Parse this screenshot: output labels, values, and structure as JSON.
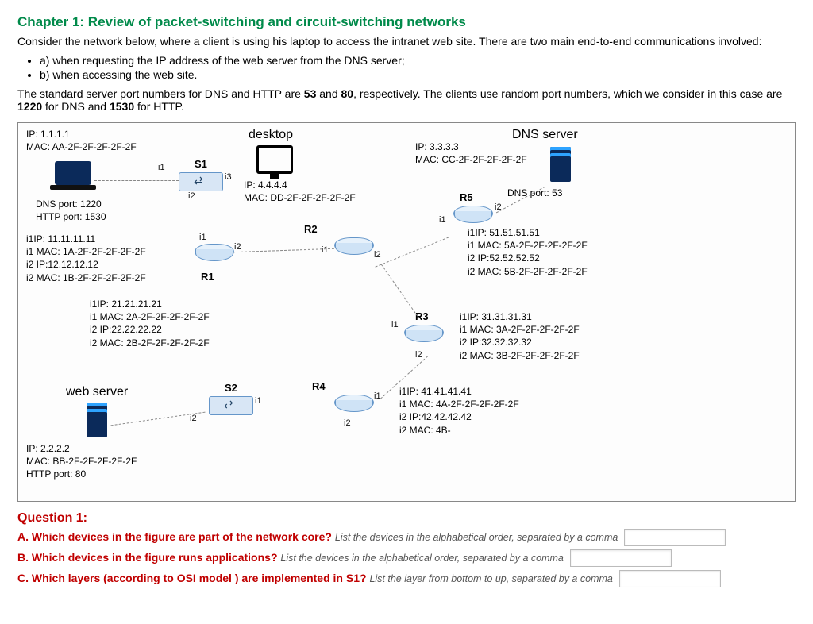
{
  "chapter_title": "Chapter 1: Review of packet-switching and circuit-switching networks",
  "intro": "Consider the network below, where a client is using his laptop to access the intranet web site. There are two main end-to-end communications involved:",
  "scenarios": [
    "a) when requesting the IP address of the web server from the DNS server;",
    "b) when accessing the web site."
  ],
  "ports_note_parts": {
    "p1": "The standard server port numbers for DNS and HTTP are ",
    "dns_srv_port": "53",
    "p2": " and ",
    "http_srv_port": "80",
    "p3": ", respectively. The clients use random port numbers, which we consider in this case are ",
    "client_dns": "1220",
    "p4": " for DNS and ",
    "client_http": "1530",
    "p5": " for HTTP."
  },
  "diagram": {
    "labels": {
      "desktop": "desktop",
      "dns_server": "DNS server",
      "web_server": "web server",
      "S1": "S1",
      "S2": "S2",
      "R1": "R1",
      "R2": "R2",
      "R3": "R3",
      "R4": "R4",
      "R5": "R5"
    },
    "laptop": {
      "ip_line": "IP: 1.1.1.1",
      "mac_line": "MAC: AA-2F-2F-2F-2F-2F",
      "dns_port": "DNS port: 1220",
      "http_port": "HTTP port: 1530"
    },
    "desktop_info": {
      "ip_line": "IP: 4.4.4.4",
      "mac_line": "MAC: DD-2F-2F-2F-2F-2F"
    },
    "dns_info": {
      "ip_line": "IP: 3.3.3.3",
      "mac_line": "MAC: CC-2F-2F-2F-2F-2F",
      "port_line": "DNS port: 53"
    },
    "web_info": {
      "ip_line": "IP: 2.2.2.2",
      "mac_line": "MAC: BB-2F-2F-2F-2F-2F",
      "port_line": "HTTP port: 80"
    },
    "R1": {
      "l1": "i1IP: 11.11.11.11",
      "l2": "i1 MAC: 1A-2F-2F-2F-2F-2F",
      "l3": "i2 IP:12.12.12.12",
      "l4": "i2 MAC: 1B-2F-2F-2F-2F-2F"
    },
    "R2": {
      "l1": "i1IP: 21.21.21.21",
      "l2": "i1 MAC: 2A-2F-2F-2F-2F-2F",
      "l3": "i2 IP:22.22.22.22",
      "l4": "i2 MAC: 2B-2F-2F-2F-2F-2F"
    },
    "R3": {
      "l1": "i1IP: 31.31.31.31",
      "l2": "i1 MAC: 3A-2F-2F-2F-2F-2F",
      "l3": "i2 IP:32.32.32.32",
      "l4": "i2 MAC: 3B-2F-2F-2F-2F-2F"
    },
    "R4": {
      "l1": "i1IP: 41.41.41.41",
      "l2": "i1 MAC: 4A-2F-2F-2F-2F-2F",
      "l3": "i2 IP:42.42.42.42",
      "l4": "i2 MAC: 4B-"
    },
    "R5": {
      "l1": "i1IP: 51.51.51.51",
      "l2": "i1 MAC: 5A-2F-2F-2F-2F-2F",
      "l3": "i2 IP:52.52.52.52",
      "l4": "i2 MAC: 5B-2F-2F-2F-2F-2F"
    },
    "iface": {
      "i1": "i1",
      "i2": "i2",
      "i3": "i3"
    }
  },
  "question": {
    "title": "Question 1:",
    "A": {
      "lead": "A. Which devices in the figure are part of the network core? ",
      "hint": "List the devices in the alphabetical order, separated by a comma"
    },
    "B": {
      "lead": "B. Which devices in the figure runs applications? ",
      "hint": "List the devices in the alphabetical order, separated by a comma"
    },
    "C": {
      "lead": "C. Which layers (according to OSI model ) are implemented in S1? ",
      "hint": "List the layer from bottom to up, separated by a comma"
    }
  }
}
